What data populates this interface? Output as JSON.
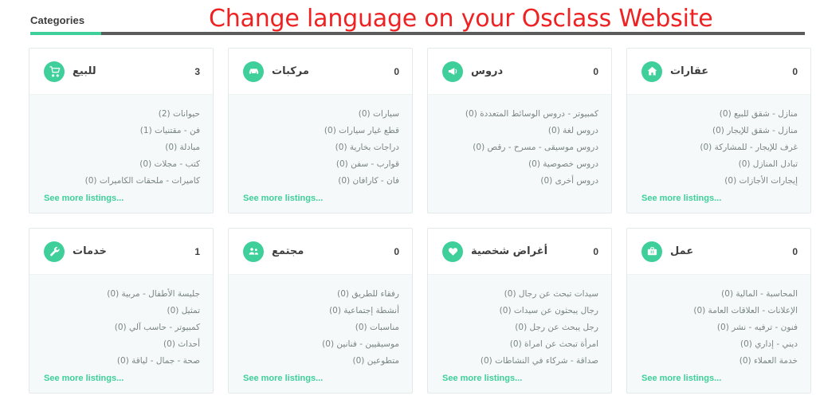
{
  "header": {
    "title": "Categories",
    "overlay_text": "Change language on your Osclass Website",
    "accent_color": "#3ecf9a",
    "overlay_color": "#ee2222",
    "rule_color": "#5b5b5b"
  },
  "see_more_label": "See more listings...",
  "categories": [
    {
      "name": "للبيع",
      "count": "3",
      "icon": "shopping-cart-icon",
      "subcategories": [
        "حيوانات (2)",
        "فن - مقتنيات (1)",
        "مبادلة (0)",
        "كتب - مجلات (0)",
        "كاميرات - ملحقات الكاميرات (0)"
      ],
      "has_see_more": true
    },
    {
      "name": "مركبات",
      "count": "0",
      "icon": "car-icon",
      "subcategories": [
        "سيارات (0)",
        "قطع غيار سيارات (0)",
        "دراجات بخارية (0)",
        "قوارب - سفن (0)",
        "فان - كارافان (0)"
      ],
      "has_see_more": true
    },
    {
      "name": "دروس",
      "count": "0",
      "icon": "megaphone-icon",
      "subcategories": [
        "كمبيوتر - دروس الوسائط المتعددة (0)",
        "دروس لغة (0)",
        "دروس موسيقى - مسرح - رقص (0)",
        "دروس خصوصية (0)",
        "دروس أخرى (0)"
      ],
      "has_see_more": false
    },
    {
      "name": "عقارات",
      "count": "0",
      "icon": "home-icon",
      "subcategories": [
        "منازل - شقق للبيع (0)",
        "منازل - شقق للإيجار (0)",
        "غرف للإيجار - للمشاركة (0)",
        "تبادل المنازل (0)",
        "إيجارات الأجازات (0)"
      ],
      "has_see_more": true
    },
    {
      "name": "خدمات",
      "count": "1",
      "icon": "wrench-icon",
      "subcategories": [
        "جليسة الأطفال - مربية (0)",
        "تمثيل (0)",
        "كمبيوتر - حاسب آلي (0)",
        "أحداث (0)",
        "صحة - جمال - لياقة (0)"
      ],
      "has_see_more": true
    },
    {
      "name": "مجتمع",
      "count": "0",
      "icon": "users-icon",
      "subcategories": [
        "رفقاء للطريق (0)",
        "أنشطة إجتماعية (0)",
        "مناسبات (0)",
        "موسيقيين - فنانين (0)",
        "متطوعين (0)"
      ],
      "has_see_more": true
    },
    {
      "name": "أغراض شخصية",
      "count": "0",
      "icon": "heart-icon",
      "subcategories": [
        "سيدات تبحث عن رجال (0)",
        "رجال يبحثون عن سيدات (0)",
        "رجل يبحث عن رجل (0)",
        "امرأة تبحث عن امراة (0)",
        "صداقة - شركاء في النشاطات (0)"
      ],
      "has_see_more": true
    },
    {
      "name": "عمل",
      "count": "0",
      "icon": "briefcase-icon",
      "subcategories": [
        "المحاسبة - المالية (0)",
        "الإعلانات - العلاقات العامة (0)",
        "فنون - ترفيه - نشر (0)",
        "ديني - إداري (0)",
        "خدمة العملاء (0)"
      ],
      "has_see_more": true
    }
  ]
}
